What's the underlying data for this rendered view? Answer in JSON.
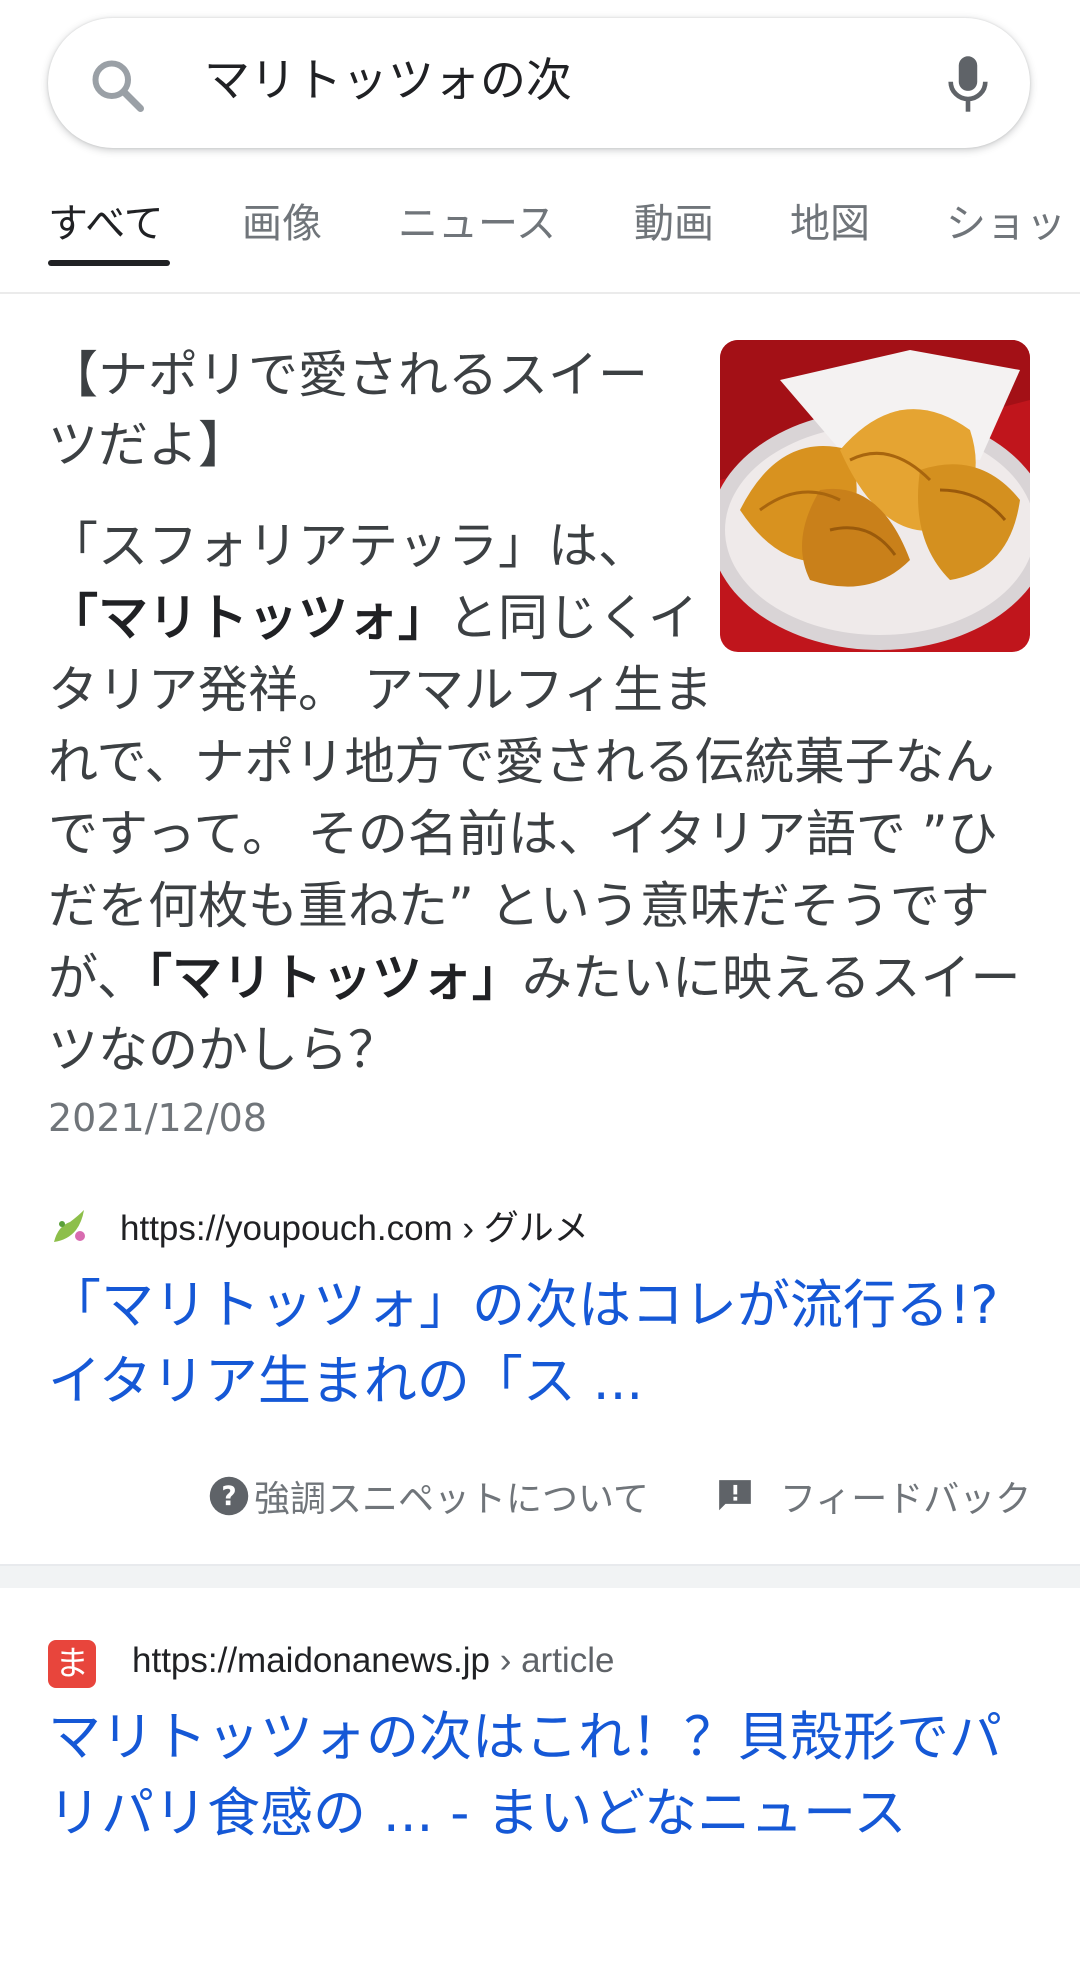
{
  "search": {
    "query": "マリトッツォの次"
  },
  "tabs": [
    {
      "label": "すべて",
      "active": true
    },
    {
      "label": "画像",
      "active": false
    },
    {
      "label": "ニュース",
      "active": false
    },
    {
      "label": "動画",
      "active": false
    },
    {
      "label": "地図",
      "active": false
    },
    {
      "label": "ショッ",
      "active": false
    }
  ],
  "snippet": {
    "heading": "【ナポリで愛されるスイーツだよ】",
    "body_parts": [
      {
        "text": "「スフォリアテッラ」は、",
        "bold": false
      },
      {
        "text": "「マリトッツォ」",
        "bold": true
      },
      {
        "text": "と同じくイタリア発祥。 アマルフィ生まれで、ナポリ地方で愛される伝統菓子なんですって。 その名前は、イタリア語で ”ひだを何枚も重ねた” という意味だそうですが、",
        "bold": false
      },
      {
        "text": "「マリトッツォ」",
        "bold": true
      },
      {
        "text": "みたいに映えるスイーツなのかしら？",
        "bold": false
      }
    ],
    "date": "2021/12/08",
    "image_alt": "sfogliatella pastries"
  },
  "source1": {
    "url": "https://youpouch.com",
    "crumb": " › グルメ",
    "title": "「マリトッツォ」の次はコレが流行る!? イタリア生まれの「ス ..."
  },
  "snippet_footer": {
    "about_label": "強調スニペットについて",
    "feedback_label": "フィードバック"
  },
  "result2": {
    "favicon_char": "ま",
    "url": "https://maidonanews.jp",
    "crumb": " › article",
    "title": "マリトッツォの次はこれ！？貝殻形でパリパリ食感の ... - まいどなニュース"
  },
  "colors": {
    "link": "#1558d6",
    "text": "#202124",
    "muted": "#70757a",
    "favicon2": "#e8453c"
  }
}
